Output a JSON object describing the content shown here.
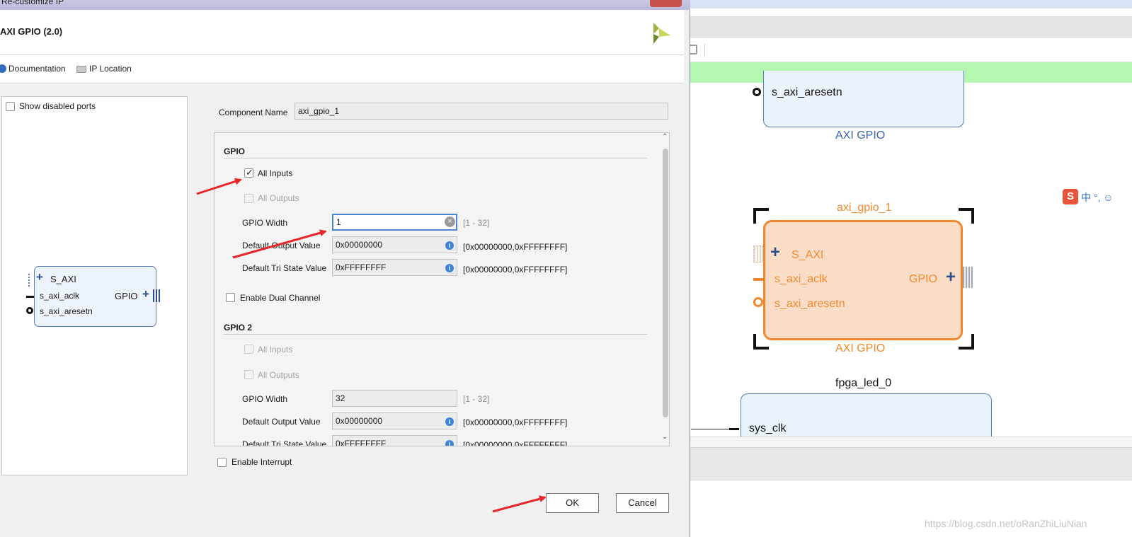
{
  "dialog": {
    "window_title": "Re-customize IP",
    "header_title": "AXI GPIO (2.0)",
    "links": {
      "documentation": "Documentation",
      "ip_location": "IP Location"
    },
    "show_disabled_ports": "Show disabled ports",
    "symbol": {
      "s_axi": "S_AXI",
      "s_axi_aclk": "s_axi_aclk",
      "s_axi_aresetn": "s_axi_aresetn",
      "gpio": "GPIO"
    },
    "component_name_label": "Component Name",
    "component_name_value": "axi_gpio_1",
    "gpio": {
      "title": "GPIO",
      "all_inputs": "All Inputs",
      "all_inputs_checked": true,
      "all_outputs": "All Outputs",
      "gpio_width_label": "GPIO Width",
      "gpio_width_value": "1",
      "gpio_width_range": "[1 - 32]",
      "default_output_label": "Default Output Value",
      "default_output_value": "0x00000000",
      "default_output_range": "[0x00000000,0xFFFFFFFF]",
      "default_tri_label": "Default Tri State Value",
      "default_tri_value": "0xFFFFFFFF",
      "default_tri_range": "[0x00000000,0xFFFFFFFF]",
      "enable_dual_channel": "Enable Dual Channel"
    },
    "gpio2": {
      "title": "GPIO 2",
      "all_inputs": "All Inputs",
      "all_outputs": "All Outputs",
      "gpio_width_label": "GPIO Width",
      "gpio_width_value": "32",
      "gpio_width_range": "[1 - 32]",
      "default_output_label": "Default Output Value",
      "default_output_value": "0x00000000",
      "default_output_range": "[0x00000000,0xFFFFFFFF]",
      "default_tri_label": "Default Tri State Value",
      "default_tri_value": "0xFFFFFFFF",
      "default_tri_range": "[0x00000000,0xFFFFFFFF]"
    },
    "enable_interrupt": "Enable Interrupt",
    "ok": "OK",
    "cancel": "Cancel"
  },
  "canvas": {
    "top_block_port": "s_axi_aresetn",
    "top_block_caption": "AXI GPIO",
    "selected_block_name": "axi_gpio_1",
    "selected_block_ports": {
      "s_axi": "S_AXI",
      "s_axi_aclk": "s_axi_aclk",
      "s_axi_aresetn": "s_axi_aresetn",
      "gpio": "GPIO"
    },
    "selected_block_caption": "AXI GPIO",
    "led_block_name": "fpga_led_0",
    "led_block_port": "sys_clk"
  },
  "ime_bar": {
    "logo": "S",
    "text": "中 °, ☺"
  },
  "watermark": "https://blog.csdn.net/oRanZhiLiuNian",
  "colors": {
    "arrow": "#e8262a",
    "selected_block": "#f5862a",
    "header_bg": "#ffffff",
    "green_banner": "#b4f7b0"
  }
}
